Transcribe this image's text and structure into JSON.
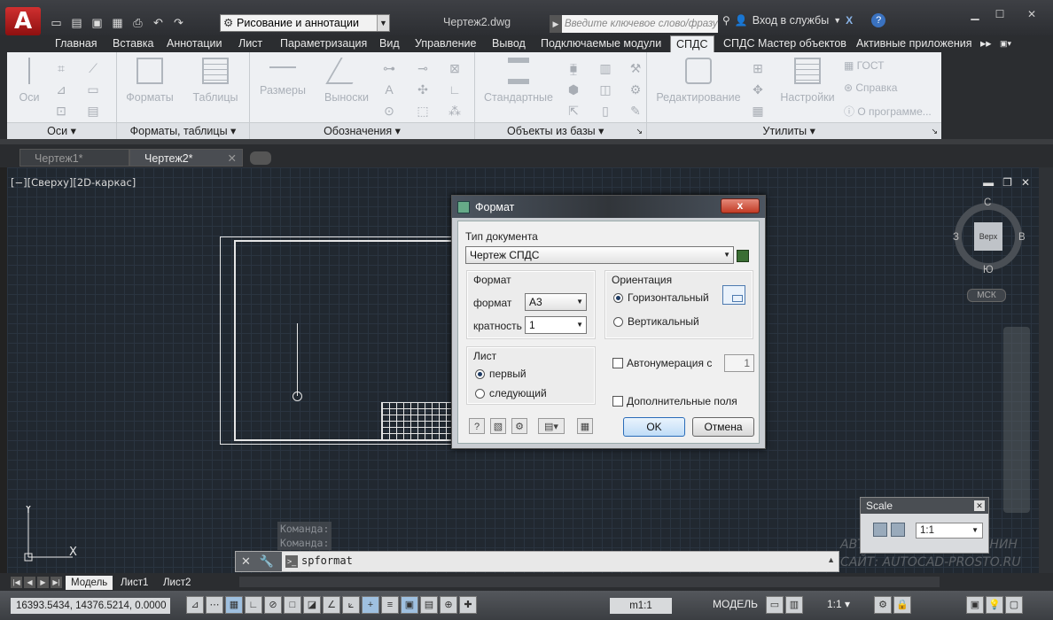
{
  "title_bar": {
    "logo": "A",
    "workspace": "Рисование и аннотации",
    "document_title": "Чертеж2.dwg",
    "search_placeholder": "Введите ключевое слово/фразу",
    "signin": "Вход в службы"
  },
  "ribbon": {
    "tabs": [
      "Главная",
      "Вставка",
      "Аннотации",
      "Лист",
      "Параметризация",
      "Вид",
      "Управление",
      "Вывод",
      "Подключаемые модули",
      "СПДС",
      "СПДС Мастер объектов",
      "Активные приложения"
    ],
    "active_tab": "СПДС",
    "groups": {
      "axes": {
        "title": "Оси",
        "big": "Оси"
      },
      "formats": {
        "title": "Форматы, таблицы",
        "formats": "Форматы",
        "tables": "Таблицы"
      },
      "designations": {
        "title": "Обозначения",
        "dimensions": "Размеры",
        "leaders": "Выноски"
      },
      "base_objects": {
        "title": "Объекты из базы",
        "standard": "Стандартные"
      },
      "utilities": {
        "title": "Утилиты",
        "editing": "Редактирование",
        "settings": "Настройки",
        "gost": "ГОСТ",
        "help": "Справка",
        "about": "О программе..."
      }
    }
  },
  "doc_tabs": [
    "Чертеж1*",
    "Чертеж2*"
  ],
  "viewport": {
    "label": "[−][Сверху][2D-каркас]",
    "viewcube": {
      "top": "Верх",
      "n": "С",
      "s": "Ю",
      "w": "З",
      "e": "В"
    },
    "wcs": "МСК"
  },
  "command": {
    "history": [
      "Команда:",
      "Команда:"
    ],
    "current": "spformat"
  },
  "watermark": [
    "АВТОР: АЛЕКСЕЙ КАНАНИН",
    "САЙТ: AUTOCAD-PROSTO.RU"
  ],
  "scale_window": {
    "title": "Scale",
    "value": "1:1"
  },
  "layout_tabs": [
    "Модель",
    "Лист1",
    "Лист2"
  ],
  "status": {
    "coords": "16393.5434, 14376.5214, 0.0000",
    "scale": "m1:1",
    "model": "МОДЕЛЬ",
    "anno_scale": "1:1"
  },
  "dialog": {
    "title": "Формат",
    "close": "x",
    "doc_type_label": "Тип документа",
    "doc_type_value": "Чертеж СПДС",
    "format_group": "Формат",
    "format_label": "формат",
    "format_value": "A3",
    "multiplicity_label": "кратность",
    "multiplicity_value": "1",
    "orientation_group": "Ориентация",
    "orient_horizontal": "Горизонтальный",
    "orient_vertical": "Вертикальный",
    "sheet_group": "Лист",
    "sheet_first": "первый",
    "sheet_next": "следующий",
    "autonum_label": "Автонумерация с",
    "autonum_value": "1",
    "extra_fields_label": "Дополнительные поля",
    "ok": "OK",
    "cancel": "Отмена"
  }
}
